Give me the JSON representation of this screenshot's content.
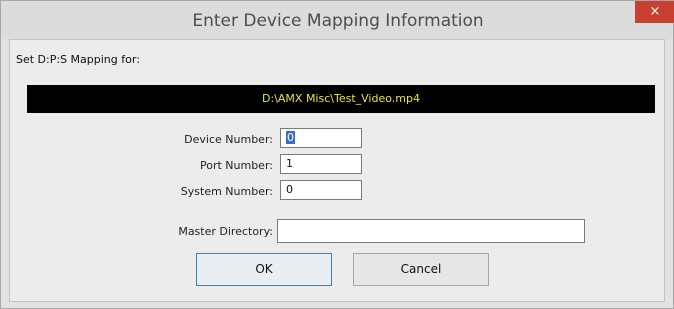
{
  "window": {
    "title": "Enter Device Mapping Information",
    "close_glyph": "×"
  },
  "mapping": {
    "label": "Set D:P:S Mapping for:",
    "file_path": "D:\\AMX Misc\\Test_Video.mp4"
  },
  "form": {
    "device_label": "Device Number:",
    "device_value": "0",
    "port_label": "Port Number:",
    "port_value": "1",
    "system_label": "System Number:",
    "system_value": "0",
    "master_label": "Master Directory:",
    "master_value": ""
  },
  "buttons": {
    "ok": "OK",
    "cancel": "Cancel"
  },
  "colors": {
    "path_bar_bg": "#000000",
    "path_text": "#e9e43a",
    "close_button": "#c84031"
  }
}
